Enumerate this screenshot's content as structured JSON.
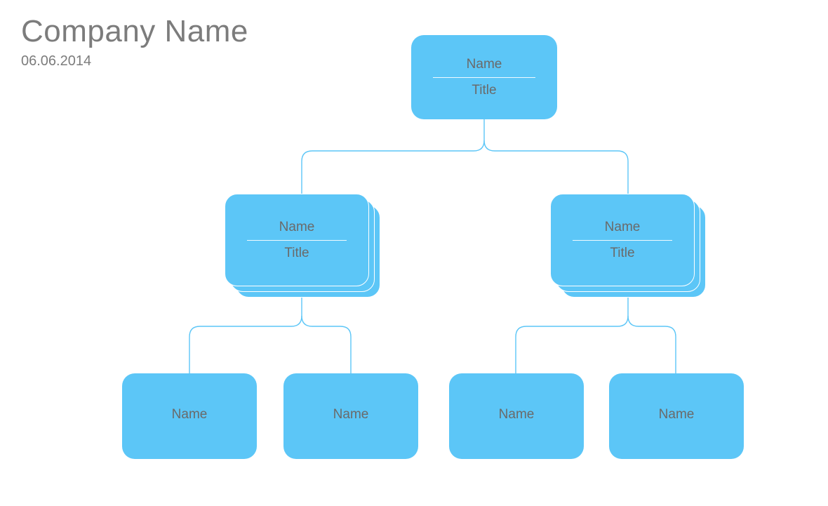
{
  "header": {
    "company": "Company Name",
    "date": "06.06.2014"
  },
  "org": {
    "root": {
      "name": "Name",
      "title": "Title"
    },
    "level2": [
      {
        "name": "Name",
        "title": "Title"
      },
      {
        "name": "Name",
        "title": "Title"
      }
    ],
    "level3": [
      {
        "name": "Name"
      },
      {
        "name": "Name"
      },
      {
        "name": "Name"
      },
      {
        "name": "Name"
      }
    ]
  },
  "colors": {
    "node": "#5cc6f7",
    "text": "#6a6a6a"
  }
}
